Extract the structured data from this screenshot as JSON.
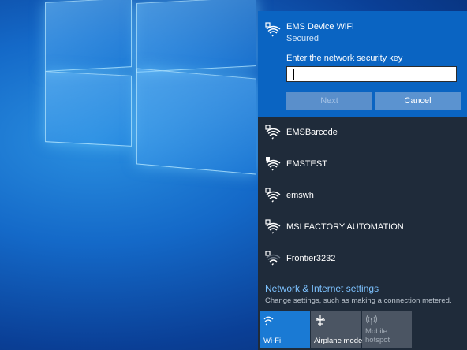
{
  "selected_network": {
    "ssid": "EMS Device WiFi",
    "status": "Secured",
    "key_prompt": "Enter the network security key",
    "key_value": "",
    "next_label": "Next",
    "cancel_label": "Cancel"
  },
  "networks": [
    {
      "ssid": "EMSBarcode",
      "icon": "wifi-secured-icon"
    },
    {
      "ssid": "EMSTEST",
      "icon": "wifi-shield-icon"
    },
    {
      "ssid": "emswh",
      "icon": "wifi-secured-icon"
    },
    {
      "ssid": "MSI FACTORY AUTOMATION",
      "icon": "wifi-secured-icon"
    },
    {
      "ssid": "Frontier3232",
      "icon": "wifi-weak-secured-icon"
    }
  ],
  "settings": {
    "link": "Network & Internet settings",
    "description": "Change settings, such as making a connection metered."
  },
  "quick_actions": [
    {
      "label": "Wi-Fi",
      "icon": "wifi-icon",
      "active": true
    },
    {
      "label": "Airplane mode",
      "icon": "airplane-icon",
      "active": false
    },
    {
      "label": "Mobile hotspot",
      "icon": "hotspot-icon",
      "active": false,
      "disabled": true
    }
  ],
  "colors": {
    "flyout_bg": "#1f2b3a",
    "selected_bg": "#0a64c2",
    "accent": "#1a7ad4",
    "link": "#7dc2ff"
  }
}
